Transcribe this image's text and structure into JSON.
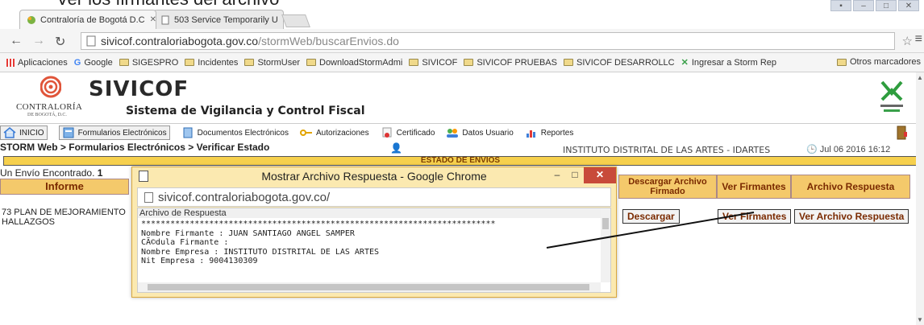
{
  "caption": "Ver los firmantes del archivo",
  "browser": {
    "tabs": [
      {
        "label": "Contraloría de Bogotá D.C"
      },
      {
        "label": "503 Service Temporarily U"
      }
    ],
    "url_host": "sivicof.contraloriabogota.gov.co",
    "url_path": "/stormWeb/buscarEnvios.do",
    "bookmarks": [
      {
        "label": "Aplicaciones"
      },
      {
        "label": "Google"
      },
      {
        "label": "SIGESPRO"
      },
      {
        "label": "Incidentes"
      },
      {
        "label": "StormUser"
      },
      {
        "label": "DownloadStormAdmi"
      },
      {
        "label": "SIVICOF"
      },
      {
        "label": "SIVICOF PRUEBAS"
      },
      {
        "label": "SIVICOF DESARROLLC"
      },
      {
        "label": "Ingresar a Storm Rep"
      }
    ],
    "other_bookmarks": "Otros marcadores",
    "colors": {
      "accent": "#f6d04d",
      "header": "#f4c96b",
      "popup": "#fbe9b0",
      "close": "#c84a3a"
    }
  },
  "header": {
    "logo_text": "CONTRALORÍA",
    "logo_sub": "DE BOGOTÁ, D.C.",
    "brand": "SIVICOF",
    "brand_sub": "Sistema de Vigilancia y Control Fiscal",
    "storm_label": "STORM WEB"
  },
  "menu": [
    {
      "label": "INICIO",
      "icon": "home-icon"
    },
    {
      "label": "Formularios Electrónicos",
      "icon": "forms-icon"
    },
    {
      "label": "Documentos Electrónicos",
      "icon": "documents-icon"
    },
    {
      "label": "Autorizaciones",
      "icon": "keys-icon"
    },
    {
      "label": "Certificado",
      "icon": "certificate-icon"
    },
    {
      "label": "Datos Usuario",
      "icon": "users-icon"
    },
    {
      "label": "Reportes",
      "icon": "chart-icon"
    }
  ],
  "breadcrumb": "STORM Web > Formularios Electrónicos > Verificar Estado",
  "entity": "INSTITUTO DISTRITAL DE LAS ARTES - IDARTES",
  "date": "Jul 06 2016 16:12",
  "status_title": "ESTADO DE ENVÍOS",
  "found_label": "Un Envío Encontrado.",
  "found_count": "1",
  "table": {
    "col_informe": "Informe",
    "col_descargar": "Descargar Archivo Firmado",
    "col_firmantes": "Ver Firmantes",
    "col_respuesta": "Archivo Respuesta",
    "row_text": "73 PLAN DE MEJORAMIENTO HALLAZGOS",
    "btn_descargar": "Descargar",
    "btn_firmantes": "Ver Firmantes",
    "btn_respuesta": "Ver Archivo Respuesta"
  },
  "popup": {
    "title": "Mostrar Archivo Respuesta - Google Chrome",
    "url": "sivicof.contraloriabogota.gov.co/",
    "section": "Archivo de Respuesta",
    "divider": "*************************************************************************",
    "line1": "Nombre Firmante : JUAN SANTIAGO ANGEL SAMPER",
    "line2": "CÃ©dula Firmante :",
    "line3": "Nombre Empresa : INSTITUTO DISTRITAL DE LAS ARTES",
    "line4": "Nit Empresa : 9004130309"
  }
}
